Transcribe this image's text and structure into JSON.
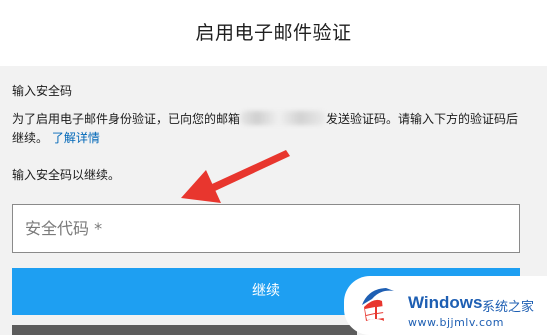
{
  "header": {
    "title": "启用电子邮件验证"
  },
  "form": {
    "section_label": "输入安全码",
    "description_before": "为了启用电子邮件身份验证，已向您的邮箱",
    "description_after": "发送验证码。请输入下方的验证码后继续。",
    "learn_more_link": "了解详情",
    "hint": "输入安全码以继续。",
    "code_placeholder": "安全代码 *",
    "code_value": "",
    "continue_button": "继续"
  },
  "watermark": {
    "brand": "Windows",
    "site_name": "系统之家",
    "url": "www.bjjmlv.com"
  },
  "colors": {
    "primary_button": "#1e9ff2",
    "link": "#0067b8",
    "annotation_arrow": "#e8362e",
    "watermark_text": "#1e5fb3"
  }
}
